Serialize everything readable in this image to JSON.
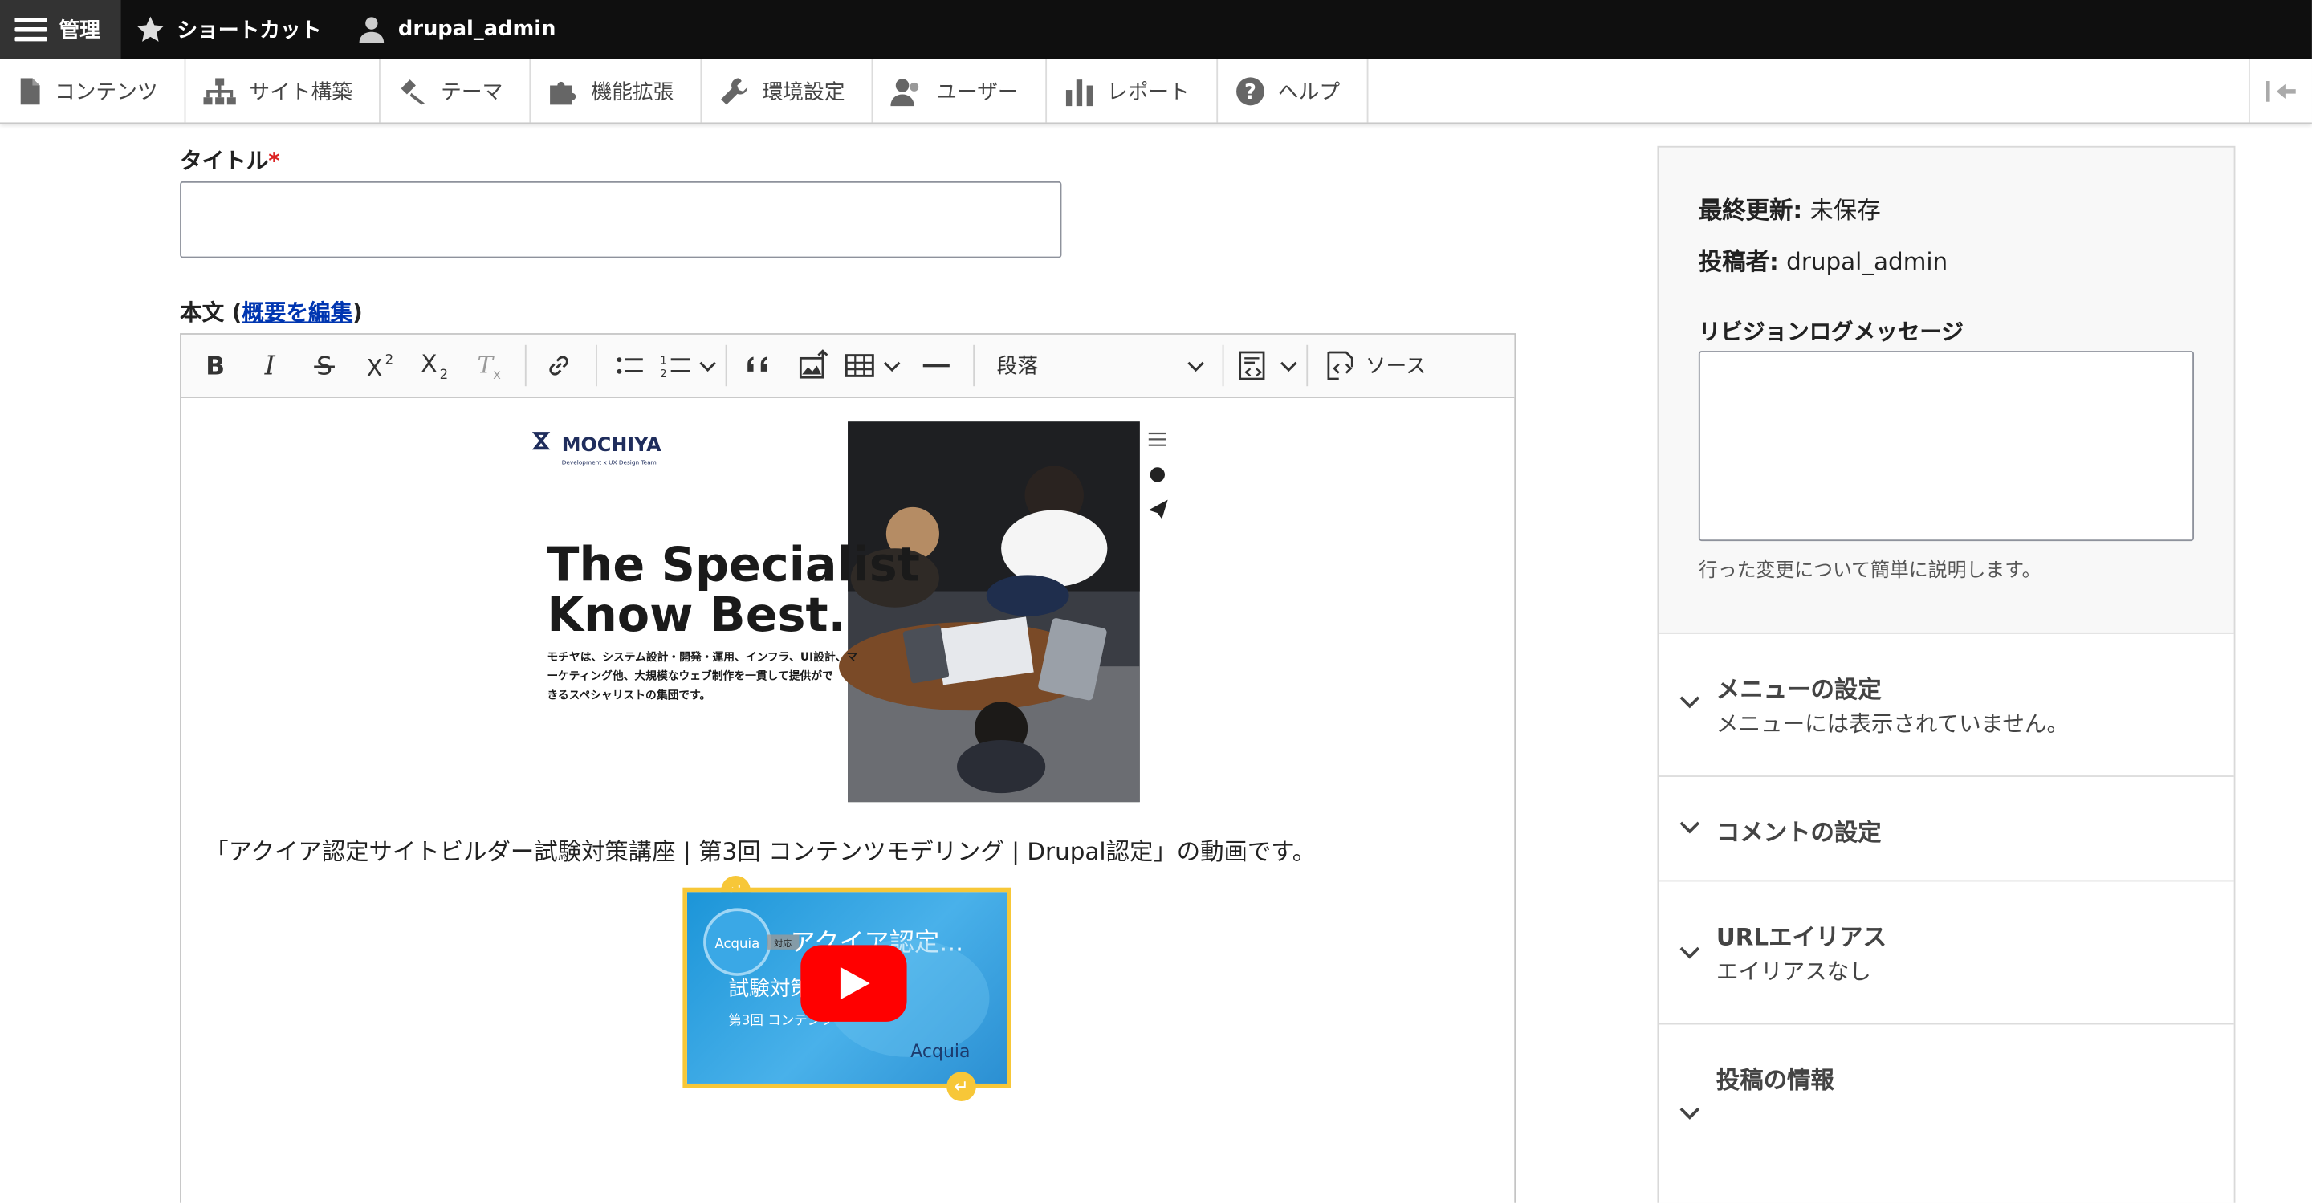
{
  "topbar": {
    "manage_label": "管理",
    "shortcuts_label": "ショートカット",
    "user_label": "drupal_admin"
  },
  "admin_menu": [
    {
      "label": "コンテンツ",
      "icon": "file-icon"
    },
    {
      "label": "サイト構築",
      "icon": "sitemap-icon"
    },
    {
      "label": "テーマ",
      "icon": "paintbrush-icon"
    },
    {
      "label": "機能拡張",
      "icon": "puzzle-icon"
    },
    {
      "label": "環境設定",
      "icon": "wrench-icon"
    },
    {
      "label": "ユーザー",
      "icon": "people-icon"
    },
    {
      "label": "レポート",
      "icon": "bar-chart-icon"
    },
    {
      "label": "ヘルプ",
      "icon": "help-icon"
    }
  ],
  "form": {
    "title_label": "タイトル",
    "required_mark": "*",
    "title_value": "",
    "body_label_prefix": "本文 (",
    "body_link": "概要を編集",
    "body_label_suffix": ")"
  },
  "editor": {
    "heading_value": "段落",
    "source_label": "ソース",
    "paragraph_text": "「アクイア認定サイトビルダー試験対策講座 | 第3回 コンテンツモデリング | Drupal認定」の動画です。",
    "image": {
      "logo_text": "MOCHIYA",
      "logo_sub": "Development x UX Design Team",
      "headline_1": "The Specialist",
      "headline_2": "Know Best.",
      "body_1": "モチヤは、システム設計・開発・運用、インフラ、UI設計、マ",
      "body_2": "ーケティング他、大規模なウェブ制作を一貫して提供がで",
      "body_3": "きるスペシャリストの集団です。"
    },
    "video": {
      "channel": "Acquia",
      "title": "アクイア認定...",
      "line1": "試験対策",
      "line2": "第3回 コンテンツ",
      "brand": "Acquia",
      "badge": "対応"
    }
  },
  "sidebar": {
    "last_saved_label": "最終更新:",
    "last_saved_value": "未保存",
    "author_label": "投稿者:",
    "author_value": "drupal_admin",
    "revision_label": "リビジョンログメッセージ",
    "revision_value": "",
    "revision_desc": "行った変更について簡単に説明します。",
    "menu_settings_title": "メニューの設定",
    "menu_settings_sub": "メニューには表示されていません。",
    "comment_settings_title": "コメントの設定",
    "url_alias_title": "URLエイリアス",
    "url_alias_sub": "エイリアスなし",
    "author_info_title": "投稿の情報"
  },
  "colors": {
    "toolbar_bg": "#0f0f0f",
    "required": "#dc2323",
    "link": "#0036b1",
    "media_outline": "#f7c738",
    "youtube_red": "#ff0000"
  }
}
